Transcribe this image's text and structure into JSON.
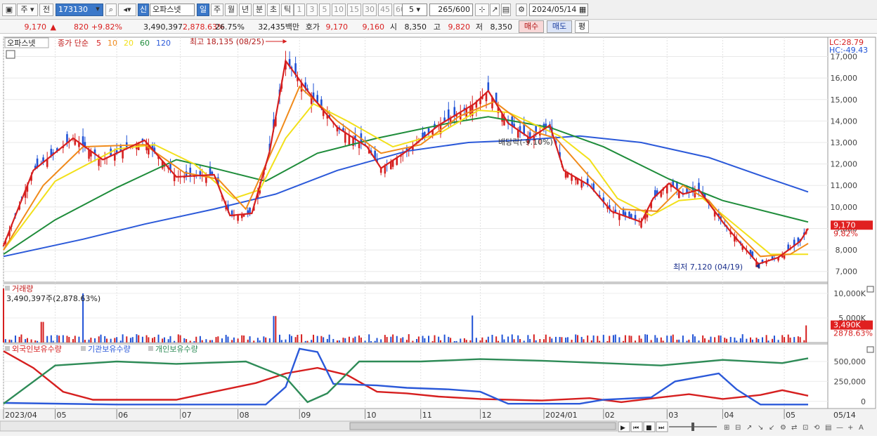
{
  "toolbar": {
    "period_day": "주",
    "code": "173130",
    "new_badge": "신",
    "stock_name": "오파스넷",
    "period_tabs": [
      "일",
      "주",
      "월",
      "년",
      "분",
      "초",
      "틱"
    ],
    "minute_tabs": [
      "1",
      "3",
      "5",
      "10",
      "15",
      "30",
      "45",
      "60"
    ],
    "count_value": "5",
    "bars_shown": "265",
    "bars_total": "/600",
    "date": "2024/05/14",
    "prev_label": "전"
  },
  "quote": {
    "price": "9,170",
    "arrow": "▲",
    "change": "820",
    "change_pct": "+9.82%",
    "volume": "3,490,397",
    "volume_ratio": "2,878.63%",
    "turnover": "26.75%",
    "amount": "32,435백만",
    "bid_label": "호가",
    "ask": "9,170",
    "bid": "9,160",
    "open_label": "시",
    "open": "8,350",
    "high_label": "고",
    "high": "9,820",
    "low_label": "저",
    "low": "8,350",
    "buy": "매수",
    "sell": "매도",
    "eval": "평"
  },
  "price_panel": {
    "name": "오파스넷",
    "series_label": "종가 단순",
    "ma": [
      {
        "period": "5",
        "color": "#d61f1f"
      },
      {
        "period": "10",
        "color": "#f08a1a"
      },
      {
        "period": "20",
        "color": "#f2e01a"
      },
      {
        "period": "60",
        "color": "#1e8c3a"
      },
      {
        "period": "120",
        "color": "#2b59d9"
      }
    ],
    "lc": "LC:28.79",
    "hc": "HC:-49.43",
    "high_note": "최고 18,135 (08/25)",
    "low_note": "최저 7,120 (04/19)",
    "dividend_note": "배당락(-9.10%)",
    "last_price": "9,170",
    "last_pct": "9.82%"
  },
  "volume_panel": {
    "title": "거래량",
    "value": "3,490,397주(2,878.63%)",
    "last": "3,490K",
    "last_pct": "2878.63%"
  },
  "holder_panel": {
    "series": [
      {
        "name": "외국인보유수량",
        "color": "#d61f1f"
      },
      {
        "name": "기관보유수량",
        "color": "#2b59d9"
      },
      {
        "name": "개인보유수량",
        "color": "#2e8b57"
      }
    ]
  },
  "x_labels": [
    {
      "label": "2023/04",
      "date": "2023-04-05"
    },
    {
      "label": "05",
      "date": "2023-05-01"
    },
    {
      "label": "06",
      "date": "2023-06-01"
    },
    {
      "label": "07",
      "date": "2023-07-03"
    },
    {
      "label": "08",
      "date": "2023-08-01"
    },
    {
      "label": "09",
      "date": "2023-09-01"
    },
    {
      "label": "10",
      "date": "2023-10-04"
    },
    {
      "label": "11",
      "date": "2023-11-01"
    },
    {
      "label": "12",
      "date": "2023-12-01"
    },
    {
      "label": "2024/01",
      "date": "2024-01-02"
    },
    {
      "label": "02",
      "date": "2024-02-01"
    },
    {
      "label": "03",
      "date": "2024-03-04"
    },
    {
      "label": "04",
      "date": "2024-04-01"
    },
    {
      "label": "05",
      "date": "2024-05-02"
    }
  ],
  "x_end_label": "05/14",
  "chart_data": [
    {
      "type": "line",
      "x_range": [
        "2023-04-05",
        "2024-05-14"
      ],
      "ylim": [
        6500,
        17900
      ],
      "yticks": [
        "7,000",
        "8,000",
        "9,000",
        "10,000",
        "11,000",
        "12,000",
        "13,000",
        "14,000",
        "15,000",
        "16,000",
        "17,000"
      ],
      "grid": true,
      "series": [
        {
          "name": "5",
          "points": [
            [
              "2023-04-05",
              8200
            ],
            [
              "2023-04-20",
              11700
            ],
            [
              "2023-05-10",
              13200
            ],
            [
              "2023-05-25",
              12200
            ],
            [
              "2023-06-15",
              13100
            ],
            [
              "2023-07-01",
              11400
            ],
            [
              "2023-07-20",
              11500
            ],
            [
              "2023-07-28",
              9600
            ],
            [
              "2023-08-08",
              9700
            ],
            [
              "2023-08-17",
              12600
            ],
            [
              "2023-08-25",
              16800
            ],
            [
              "2023-09-05",
              15400
            ],
            [
              "2023-09-20",
              13700
            ],
            [
              "2023-10-05",
              12800
            ],
            [
              "2023-10-12",
              11800
            ],
            [
              "2023-10-25",
              12600
            ],
            [
              "2023-11-10",
              13800
            ],
            [
              "2023-11-28",
              14800
            ],
            [
              "2023-12-05",
              15400
            ],
            [
              "2023-12-15",
              13900
            ],
            [
              "2023-12-26",
              13200
            ],
            [
              "2024-01-05",
              13800
            ],
            [
              "2024-01-12",
              11700
            ],
            [
              "2024-01-25",
              11000
            ],
            [
              "2024-02-05",
              9800
            ],
            [
              "2024-02-20",
              9300
            ],
            [
              "2024-02-26",
              10400
            ],
            [
              "2024-03-05",
              11100
            ],
            [
              "2024-03-12",
              10600
            ],
            [
              "2024-03-20",
              10800
            ],
            [
              "2024-04-01",
              9300
            ],
            [
              "2024-04-10",
              8300
            ],
            [
              "2024-04-19",
              7350
            ],
            [
              "2024-04-29",
              7650
            ],
            [
              "2024-05-10",
              8400
            ],
            [
              "2024-05-14",
              9000
            ]
          ]
        },
        {
          "name": "10",
          "points": [
            [
              "2023-04-05",
              8000
            ],
            [
              "2023-04-25",
              11000
            ],
            [
              "2023-05-15",
              12800
            ],
            [
              "2023-06-15",
              12900
            ],
            [
              "2023-07-05",
              11600
            ],
            [
              "2023-07-22",
              11300
            ],
            [
              "2023-08-05",
              9900
            ],
            [
              "2023-08-20",
              13000
            ],
            [
              "2023-09-01",
              15600
            ],
            [
              "2023-09-20",
              14000
            ],
            [
              "2023-10-12",
              12500
            ],
            [
              "2023-11-01",
              12900
            ],
            [
              "2023-11-20",
              14200
            ],
            [
              "2023-12-08",
              14900
            ],
            [
              "2023-12-28",
              13500
            ],
            [
              "2024-01-08",
              13200
            ],
            [
              "2024-01-25",
              11400
            ],
            [
              "2024-02-10",
              9900
            ],
            [
              "2024-02-28",
              9800
            ],
            [
              "2024-03-12",
              11000
            ],
            [
              "2024-03-25",
              10300
            ],
            [
              "2024-04-05",
              9100
            ],
            [
              "2024-04-20",
              7700
            ],
            [
              "2024-05-05",
              7800
            ],
            [
              "2024-05-14",
              8300
            ]
          ]
        },
        {
          "name": "20",
          "points": [
            [
              "2023-04-05",
              8000
            ],
            [
              "2023-05-01",
              11200
            ],
            [
              "2023-06-01",
              12700
            ],
            [
              "2023-06-20",
              12900
            ],
            [
              "2023-07-10",
              12000
            ],
            [
              "2023-07-30",
              10400
            ],
            [
              "2023-08-12",
              10800
            ],
            [
              "2023-08-25",
              13200
            ],
            [
              "2023-09-08",
              14800
            ],
            [
              "2023-09-25",
              14000
            ],
            [
              "2023-10-18",
              12800
            ],
            [
              "2023-11-10",
              13400
            ],
            [
              "2023-11-30",
              14500
            ],
            [
              "2023-12-15",
              14400
            ],
            [
              "2024-01-10",
              13300
            ],
            [
              "2024-01-25",
              12200
            ],
            [
              "2024-02-08",
              10400
            ],
            [
              "2024-02-25",
              9600
            ],
            [
              "2024-03-10",
              10300
            ],
            [
              "2024-03-22",
              10400
            ],
            [
              "2024-04-08",
              9100
            ],
            [
              "2024-04-25",
              7800
            ],
            [
              "2024-05-14",
              7800
            ]
          ]
        },
        {
          "name": "60",
          "points": [
            [
              "2023-04-05",
              7800
            ],
            [
              "2023-05-01",
              9400
            ],
            [
              "2023-06-01",
              10900
            ],
            [
              "2023-07-01",
              12200
            ],
            [
              "2023-07-20",
              11800
            ],
            [
              "2023-08-15",
              11200
            ],
            [
              "2023-09-10",
              12500
            ],
            [
              "2023-10-10",
              13200
            ],
            [
              "2023-11-15",
              13900
            ],
            [
              "2023-12-05",
              14200
            ],
            [
              "2024-01-05",
              13700
            ],
            [
              "2024-02-01",
              12800
            ],
            [
              "2024-03-05",
              11300
            ],
            [
              "2024-04-01",
              10300
            ],
            [
              "2024-05-14",
              9300
            ]
          ]
        },
        {
          "name": "120",
          "points": [
            [
              "2023-04-05",
              7700
            ],
            [
              "2023-05-15",
              8500
            ],
            [
              "2023-06-15",
              9200
            ],
            [
              "2023-07-20",
              9900
            ],
            [
              "2023-08-20",
              10600
            ],
            [
              "2023-09-20",
              11700
            ],
            [
              "2023-10-25",
              12600
            ],
            [
              "2023-11-25",
              13000
            ],
            [
              "2023-12-20",
              13100
            ],
            [
              "2024-01-20",
              13300
            ],
            [
              "2024-02-20",
              13000
            ],
            [
              "2024-03-25",
              12300
            ],
            [
              "2024-04-25",
              11300
            ],
            [
              "2024-05-14",
              10700
            ]
          ]
        }
      ],
      "annotations": [
        {
          "text": "최고 18,135 (08/25)",
          "x": "2023-08-25",
          "y": 18135
        },
        {
          "text": "최저 7,120 (04/19)",
          "x": "2024-04-19",
          "y": 7120
        },
        {
          "text": "배당락(-9.10%)",
          "x": "2023-12-28",
          "y": 13000
        }
      ]
    },
    {
      "type": "bar",
      "title": "거래량",
      "ylim": [
        0,
        12000
      ],
      "yticks": [
        "5,000K",
        "10,000K"
      ],
      "unit": "K",
      "spikes": [
        [
          "2023-04-05",
          11000
        ],
        [
          "2023-04-25",
          4200
        ],
        [
          "2023-05-15",
          10000
        ],
        [
          "2023-08-20",
          5400
        ],
        [
          "2023-11-28",
          5500
        ],
        [
          "2024-05-14",
          3490
        ]
      ],
      "baseline": 900
    },
    {
      "type": "line",
      "title": "보유수량",
      "ylim": [
        -90000,
        720000
      ],
      "yticks": [
        "0",
        "250,000",
        "500,000"
      ],
      "series": [
        {
          "name": "외국인보유수량",
          "points": [
            [
              "2023-04-05",
              630000
            ],
            [
              "2023-04-20",
              420000
            ],
            [
              "2023-05-05",
              120000
            ],
            [
              "2023-05-20",
              20000
            ],
            [
              "2023-07-01",
              20000
            ],
            [
              "2023-07-20",
              120000
            ],
            [
              "2023-08-10",
              230000
            ],
            [
              "2023-08-25",
              350000
            ],
            [
              "2023-09-10",
              420000
            ],
            [
              "2023-09-25",
              330000
            ],
            [
              "2023-10-10",
              120000
            ],
            [
              "2023-10-25",
              100000
            ],
            [
              "2023-11-10",
              60000
            ],
            [
              "2023-12-01",
              30000
            ],
            [
              "2024-01-01",
              10000
            ],
            [
              "2024-01-25",
              40000
            ],
            [
              "2024-02-10",
              -10000
            ],
            [
              "2024-03-01",
              50000
            ],
            [
              "2024-03-15",
              90000
            ],
            [
              "2024-04-01",
              30000
            ],
            [
              "2024-04-20",
              80000
            ],
            [
              "2024-05-01",
              140000
            ],
            [
              "2024-05-14",
              70000
            ]
          ]
        },
        {
          "name": "기관보유수량",
          "points": [
            [
              "2023-04-05",
              -20000
            ],
            [
              "2023-06-01",
              -40000
            ],
            [
              "2023-08-15",
              -40000
            ],
            [
              "2023-08-25",
              180000
            ],
            [
              "2023-09-01",
              660000
            ],
            [
              "2023-09-10",
              620000
            ],
            [
              "2023-09-18",
              220000
            ],
            [
              "2023-10-10",
              200000
            ],
            [
              "2023-10-25",
              170000
            ],
            [
              "2023-11-15",
              150000
            ],
            [
              "2023-12-01",
              120000
            ],
            [
              "2023-12-15",
              -30000
            ],
            [
              "2024-01-20",
              -30000
            ],
            [
              "2024-02-01",
              20000
            ],
            [
              "2024-02-25",
              50000
            ],
            [
              "2024-03-08",
              250000
            ],
            [
              "2024-03-30",
              350000
            ],
            [
              "2024-04-08",
              150000
            ],
            [
              "2024-04-20",
              -40000
            ],
            [
              "2024-05-14",
              -40000
            ]
          ]
        },
        {
          "name": "개인보유수량",
          "points": [
            [
              "2023-04-05",
              -30000
            ],
            [
              "2023-05-01",
              450000
            ],
            [
              "2023-06-01",
              500000
            ],
            [
              "2023-07-01",
              470000
            ],
            [
              "2023-08-05",
              500000
            ],
            [
              "2023-08-25",
              300000
            ],
            [
              "2023-09-05",
              -10000
            ],
            [
              "2023-09-15",
              100000
            ],
            [
              "2023-10-01",
              500000
            ],
            [
              "2023-11-01",
              500000
            ],
            [
              "2023-12-01",
              530000
            ],
            [
              "2024-01-01",
              510000
            ],
            [
              "2024-02-01",
              480000
            ],
            [
              "2024-03-01",
              450000
            ],
            [
              "2024-04-01",
              520000
            ],
            [
              "2024-05-01",
              480000
            ],
            [
              "2024-05-14",
              540000
            ]
          ]
        }
      ]
    }
  ]
}
